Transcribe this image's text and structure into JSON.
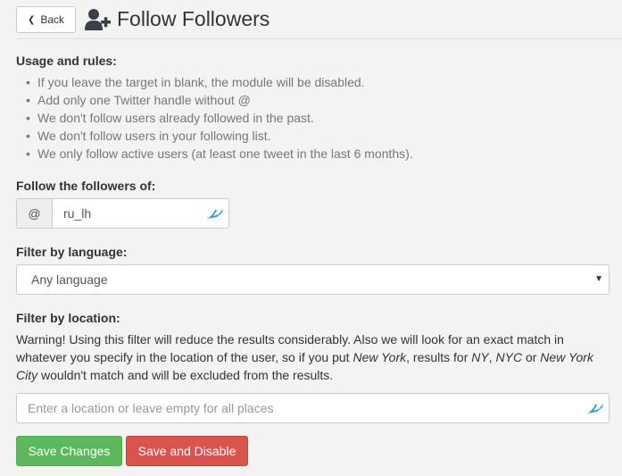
{
  "header": {
    "back_label": "Back",
    "title": "Follow Followers",
    "title_icon": "user-plus-icon"
  },
  "usage": {
    "heading": "Usage and rules:",
    "rules": [
      "If you leave the target in blank, the module will be disabled.",
      "Add only one Twitter handle without @",
      "We don't follow users already followed in the past.",
      "We don't follow users in your following list.",
      "We only follow active users (at least one tweet in the last 6 months)."
    ]
  },
  "follow_target": {
    "label": "Follow the followers of:",
    "addon": "@",
    "value": "ru_lh"
  },
  "language": {
    "label": "Filter by language:",
    "selected": "Any language"
  },
  "location": {
    "label": "Filter by location:",
    "warning_part1": "Warning! Using this filter will reduce the results considerably. Also we will look for an exact match in whatever you specify in the location of the user, so if you put ",
    "ex1": "New York",
    "warning_part2": ", results for ",
    "ex2": "NY",
    "warning_part3": ", ",
    "ex3": "NYC",
    "warning_part4": " or ",
    "ex4": "New York City",
    "warning_part5": " wouldn't match and will be excluded from the results.",
    "placeholder": "Enter a location or leave empty for all places"
  },
  "actions": {
    "save": "Save Changes",
    "disable": "Save and Disable"
  },
  "colors": {
    "save": "#5cb85c",
    "disable": "#d9534f",
    "accent_icon": "#2a9fd6"
  }
}
